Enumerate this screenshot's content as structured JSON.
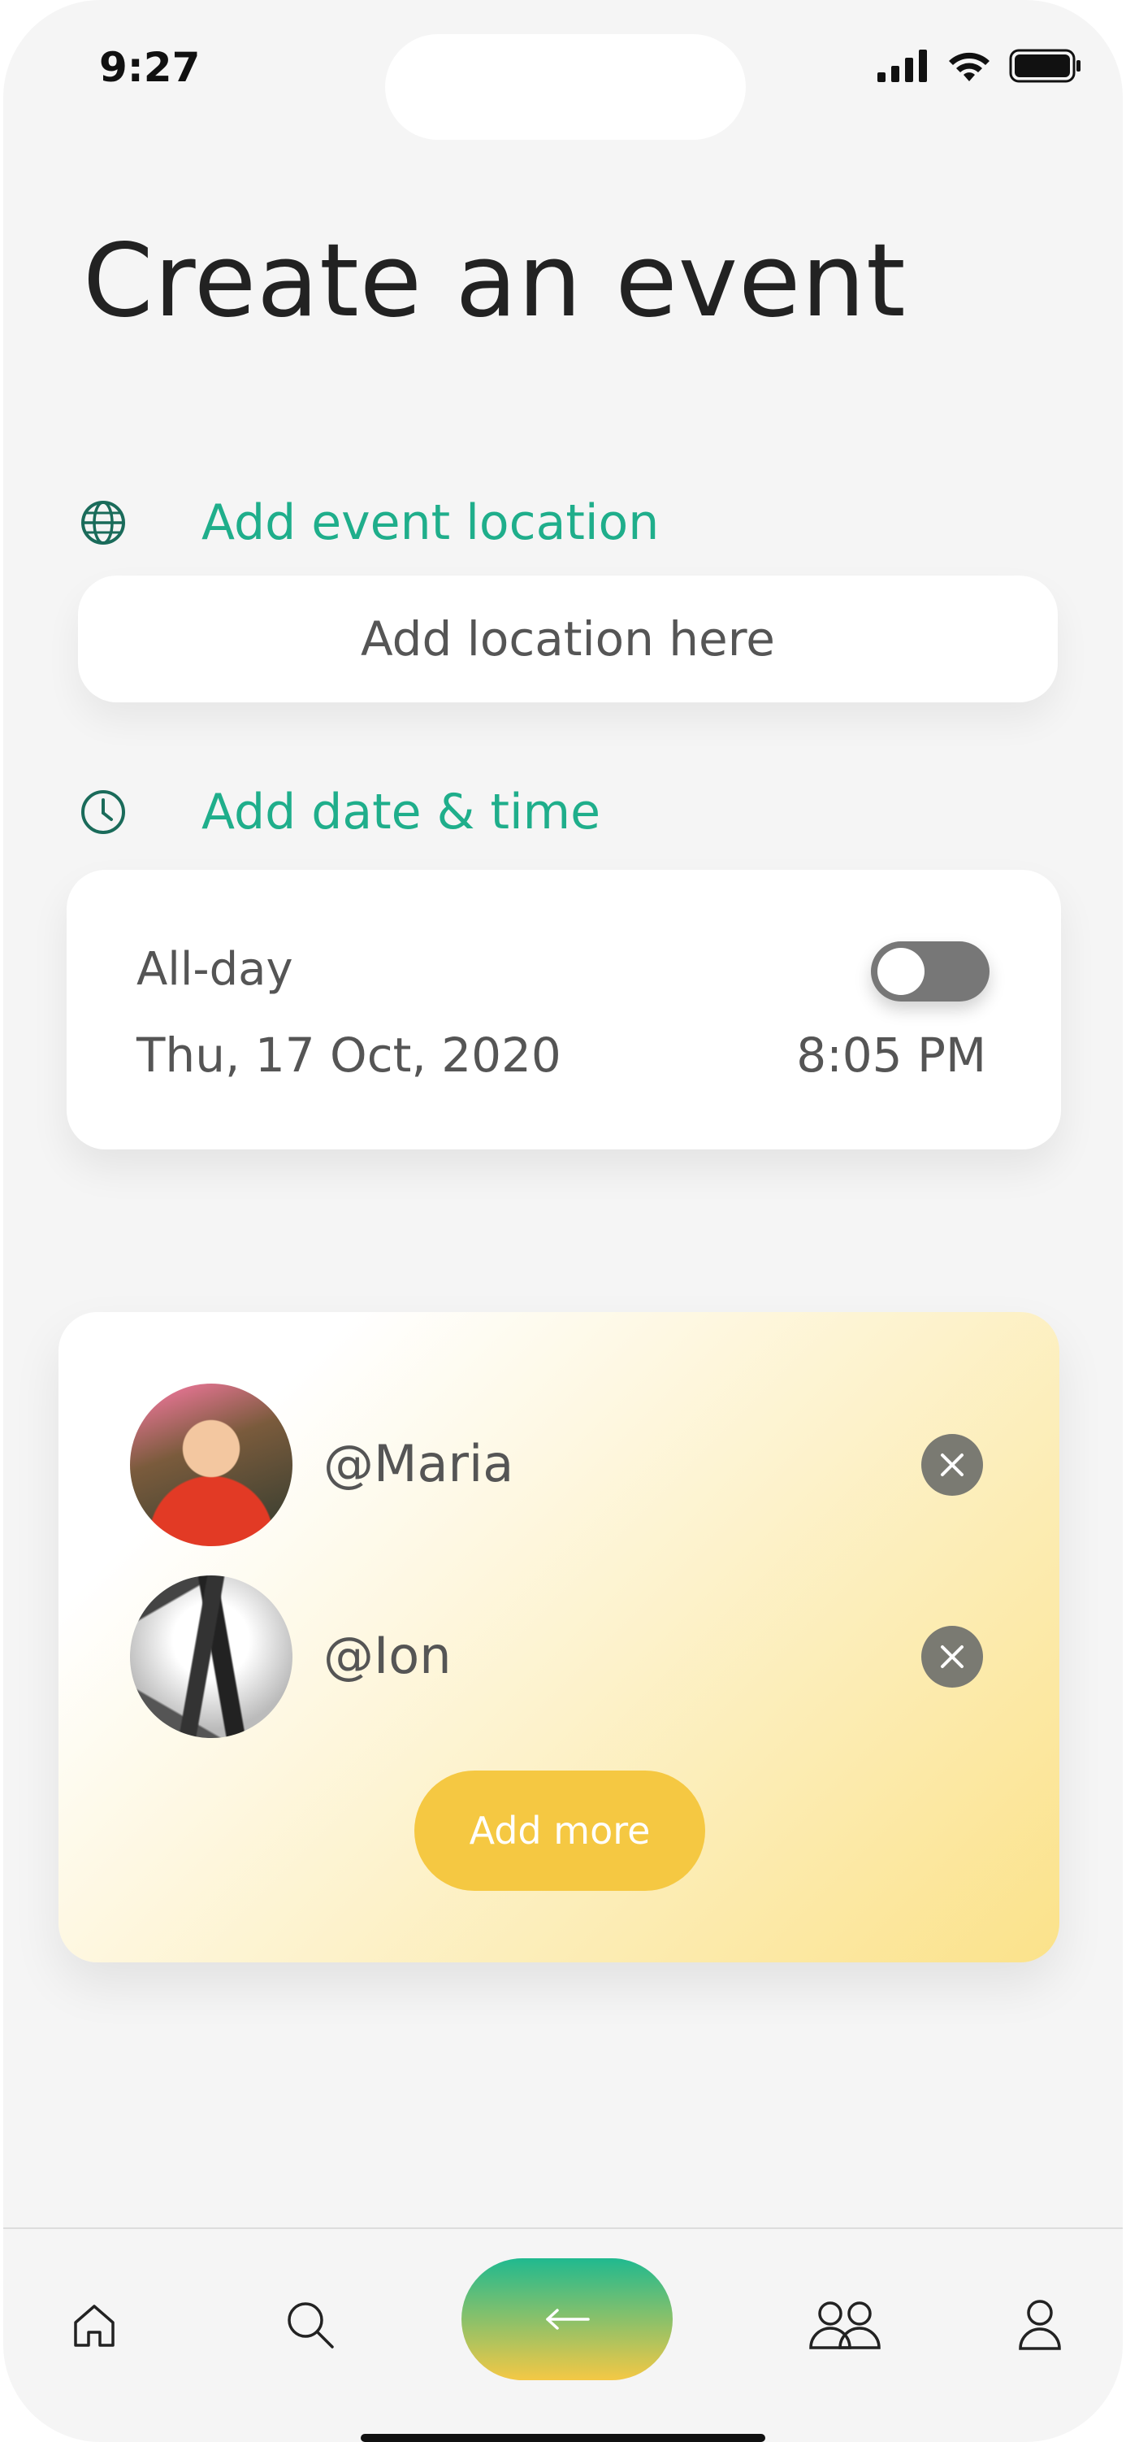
{
  "status_bar": {
    "time": "9:27"
  },
  "page": {
    "title": "Create an event"
  },
  "location": {
    "heading": "Add event location",
    "placeholder": "Add location here"
  },
  "datetime": {
    "heading": "Add date & time",
    "all_day_label": "All-day",
    "all_day_on": false,
    "date": "Thu, 17 Oct, 2020",
    "time": "8:05 PM"
  },
  "people": {
    "items": [
      {
        "handle": "@Maria"
      },
      {
        "handle": "@Ion"
      }
    ],
    "add_more_label": "Add more"
  },
  "nav": {
    "items": [
      "home-icon",
      "search-icon",
      "back-arrow-icon",
      "people-icon",
      "profile-icon"
    ]
  },
  "colors": {
    "accent": "#1fae8b",
    "button_yellow": "#f5c842",
    "background": "#f5f5f5"
  }
}
